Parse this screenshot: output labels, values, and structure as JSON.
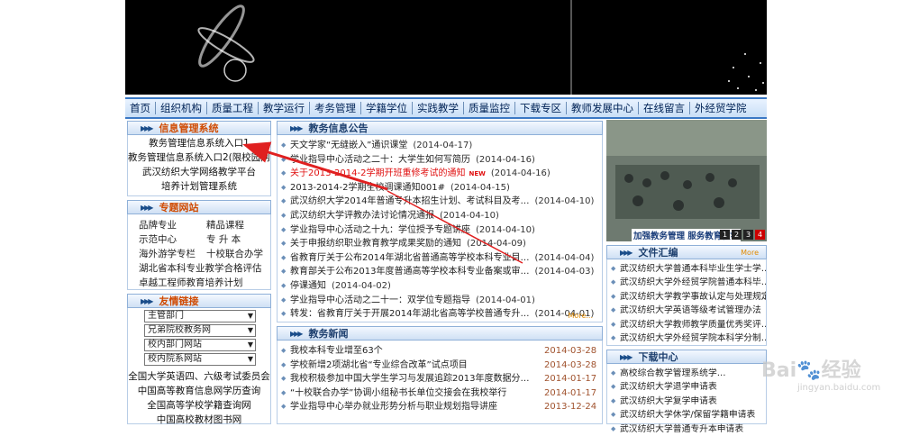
{
  "nav": [
    "首页",
    "组织机构",
    "质量工程",
    "教学运行",
    "考务管理",
    "学籍学位",
    "实践教学",
    "质量监控",
    "下载专区",
    "教师发展中心",
    "在线留言",
    "外经贸学院"
  ],
  "info_mgmt": {
    "title": "信息管理系统",
    "items": [
      "教务管理信息系统入口1",
      "教务管理信息系统入口2(限校园网访问)",
      "武汉纺织大学网络教学平台",
      "培养计划管理系统"
    ]
  },
  "topics": {
    "title": "专题网站",
    "pairs": [
      [
        "品牌专业",
        "精品课程"
      ],
      [
        "示范中心",
        "专 升 本"
      ],
      [
        "海外游学专栏",
        "十校联合办学"
      ]
    ],
    "full": [
      "湖北省本科专业教学合格评估",
      "卓越工程师教育培养计划"
    ]
  },
  "links": {
    "title": "友情链接",
    "selects": [
      "主管部门",
      "兄弟院校教务网",
      "校内部门网站",
      "校内院系网站"
    ],
    "items": [
      "全国大学英语四、六级考试委员会",
      "中国高等教育信息网学历查询",
      "全国高等学校学籍查询网",
      "中国高校教材图书网"
    ]
  },
  "notices": {
    "title": "教务信息公告",
    "more": "More...",
    "new_tag": "NEW",
    "items": [
      {
        "t": "天文学家“无缝嵌入”通识课堂",
        "d": "(2014-04-17)",
        "red": false,
        "new": false
      },
      {
        "t": "学业指导中心活动之二十：大学生如何写简历",
        "d": "(2014-04-16)",
        "red": false,
        "new": false
      },
      {
        "t": "关于2013-2014-2学期开班重修考试的通知",
        "d": "(2014-04-16)",
        "red": true,
        "new": true
      },
      {
        "t": "2013-2014-2学期全校调课通知001#",
        "d": "(2014-04-15)",
        "red": false,
        "new": false
      },
      {
        "t": "武汉纺织大学2014年普通专升本招生计划、考试科目及考…",
        "d": "(2014-04-10)",
        "red": false,
        "new": false
      },
      {
        "t": "武汉纺织大学评教办法讨论情况通报",
        "d": "(2014-04-10)",
        "red": false,
        "new": false
      },
      {
        "t": "学业指导中心活动之十九：学位授予专题讲座",
        "d": "(2014-04-10)",
        "red": false,
        "new": false
      },
      {
        "t": "关于申报纺织职业教育教学成果奖励的通知",
        "d": "(2014-04-09)",
        "red": false,
        "new": false
      },
      {
        "t": "省教育厅关于公布2014年湖北省普通高等学校本科专业目…",
        "d": "(2014-04-04)",
        "red": false,
        "new": false
      },
      {
        "t": "教育部关于公布2013年度普通高等学校本科专业备案或审…",
        "d": "(2014-04-03)",
        "red": false,
        "new": false
      },
      {
        "t": "停课通知",
        "d": "(2014-04-02)",
        "red": false,
        "new": false
      },
      {
        "t": "学业指导中心活动之二十一：双学位专题指导",
        "d": "(2014-04-01)",
        "red": false,
        "new": false
      },
      {
        "t": "转发：省教育厅关于开展2014年湖北省高等学校普通专升…",
        "d": "(2014-04-01)",
        "red": false,
        "new": false
      }
    ]
  },
  "news": {
    "title": "教务新闻",
    "items": [
      {
        "t": "我校本科专业增至63个",
        "d": "2014-03-28"
      },
      {
        "t": "学校新增2项湖北省“专业综合改革”试点项目",
        "d": "2014-03-28"
      },
      {
        "t": "我校积极参加中国大学生学习与发展追踪2013年度数据分…",
        "d": "2014-01-17"
      },
      {
        "t": "“十校联合办学”协调小组秘书长单位交接会在我校举行",
        "d": "2014-01-17"
      },
      {
        "t": "学业指导中心举办就业形势分析与职业规划指导讲座",
        "d": "2013-12-24"
      }
    ]
  },
  "photo": {
    "caption": "加强教务管理 服务教育教学",
    "nums": [
      "1",
      "2",
      "3",
      "4"
    ],
    "active": 3
  },
  "files": {
    "title": "文件汇编",
    "more": "More",
    "items": [
      "武汉纺织大学普通本科毕业生学士学…",
      "武汉纺织大学外经贸学院普通本科毕…",
      "武汉纺织大学教学事故认定与处理规定",
      "武汉纺织大学英语等级考试管理办法",
      "武汉纺织大学教师教学质量优秀奖评…",
      "武汉纺织大学外经贸学院本科学分制…"
    ]
  },
  "downloads": {
    "title": "下载中心",
    "items": [
      "高校综合教学管理系统学…",
      "武汉纺织大学退学申请表",
      "武汉纺织大学复学申请表",
      "武汉纺织大学休学/保留学籍申请表",
      "武汉纺织大学普通专升本申请表"
    ]
  },
  "watermark": {
    "brand": "Bai",
    "cn": "经验",
    "url": "jingyan.baidu.com"
  }
}
